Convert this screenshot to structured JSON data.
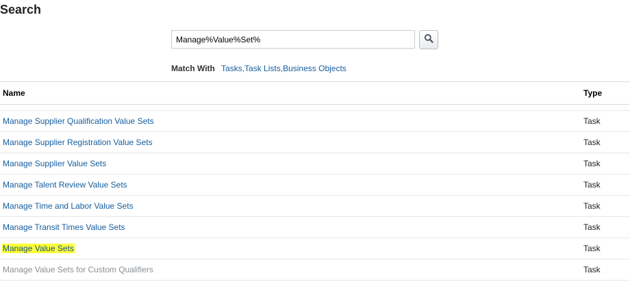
{
  "header": {
    "title": "Search"
  },
  "search": {
    "value": "Manage%Value%Set%",
    "button_icon": "search-icon"
  },
  "match": {
    "label": "Match With",
    "options": [
      "Tasks",
      "Task Lists",
      "Business Objects"
    ]
  },
  "table": {
    "columns": {
      "name": "Name",
      "type": "Type"
    },
    "rows": [
      {
        "name": "Manage Supplier Qualification Value Sets",
        "type": "Task"
      },
      {
        "name": "Manage Supplier Registration Value Sets",
        "type": "Task"
      },
      {
        "name": "Manage Supplier Value Sets",
        "type": "Task"
      },
      {
        "name": "Manage Talent Review Value Sets",
        "type": "Task"
      },
      {
        "name": "Manage Time and Labor Value Sets",
        "type": "Task"
      },
      {
        "name": "Manage Transit Times Value Sets",
        "type": "Task"
      },
      {
        "name": "Manage Value Sets",
        "type": "Task"
      },
      {
        "name": "Manage Value Sets for Custom Qualifiers",
        "type": "Task"
      }
    ]
  },
  "colors": {
    "link": "#145c9e",
    "highlight": "#fbff3a",
    "dim_link": "#8a8f94"
  }
}
